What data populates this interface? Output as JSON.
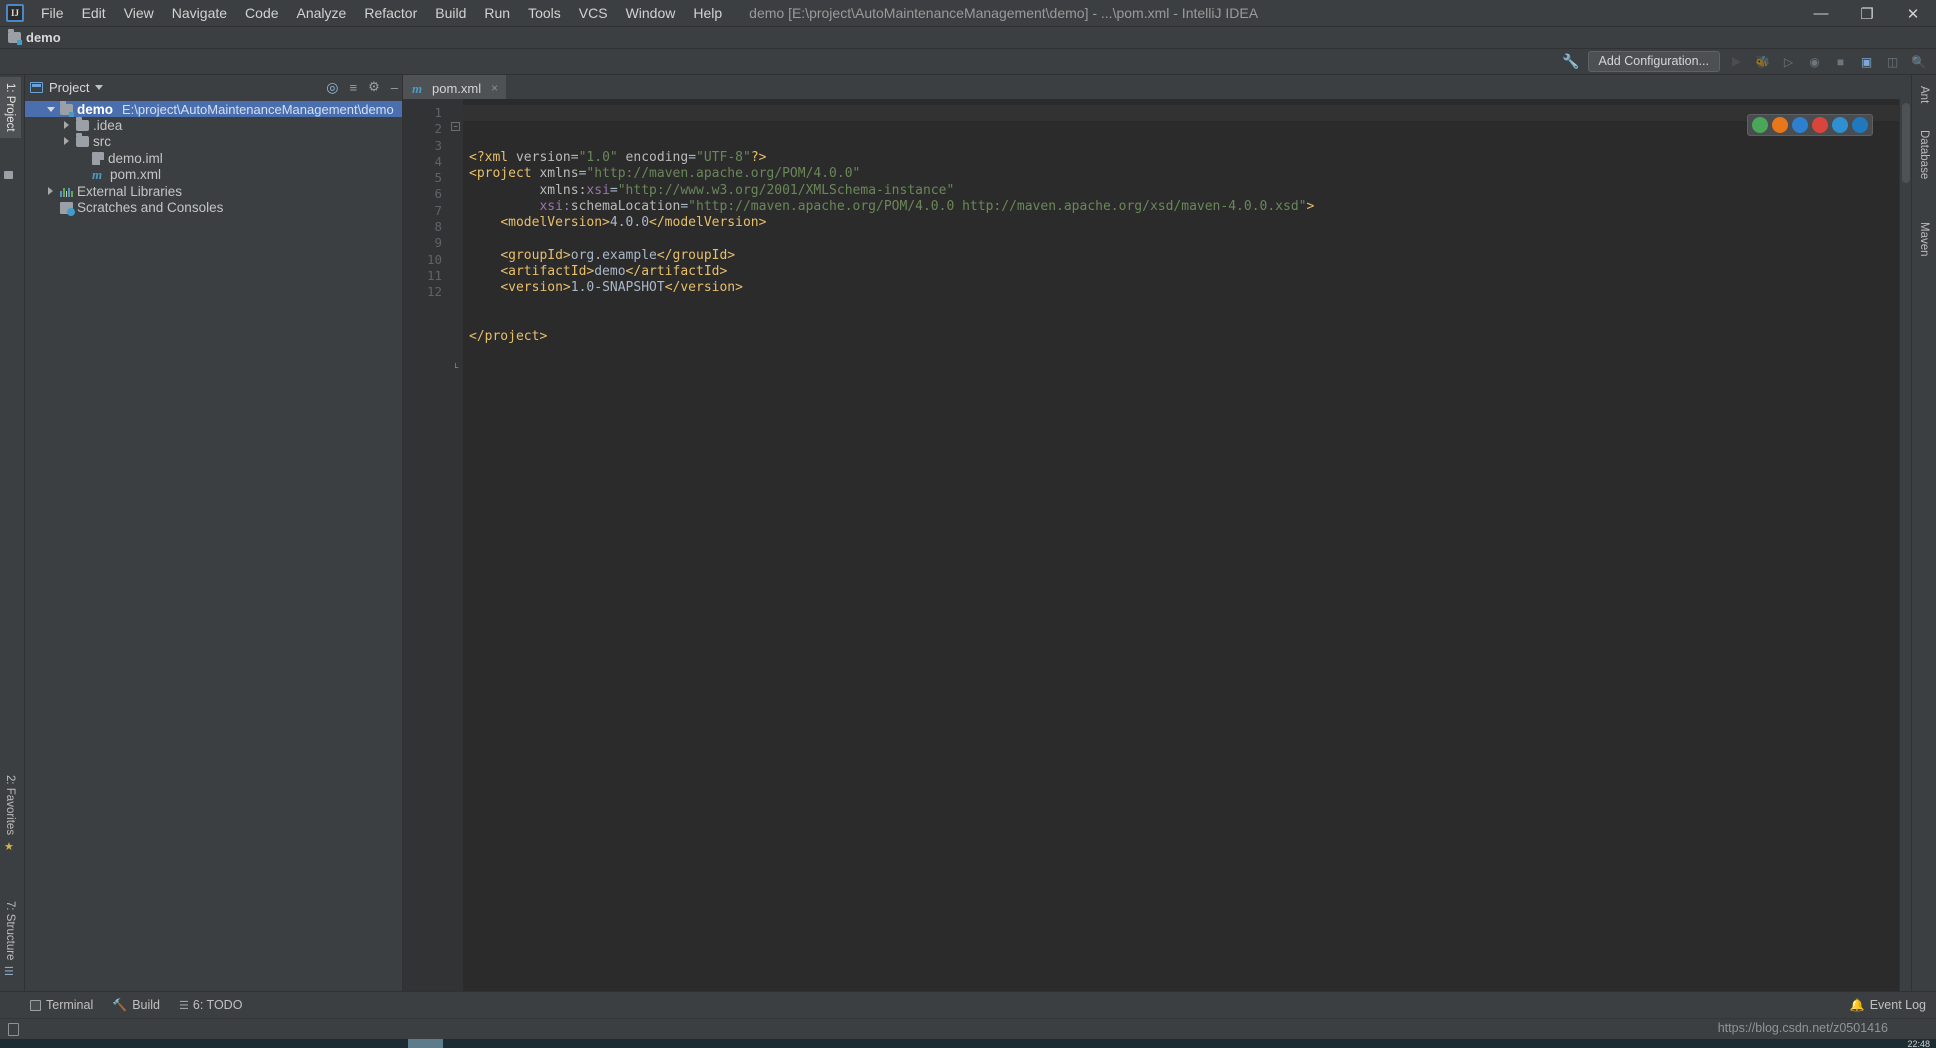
{
  "window": {
    "title": "demo [E:\\project\\AutoMaintenanceManagement\\demo] - ...\\pom.xml - IntelliJ IDEA",
    "logo": "IJ",
    "minimize": "—",
    "maximize": "❐",
    "close": "✕"
  },
  "menu": {
    "items": [
      "File",
      "Edit",
      "View",
      "Navigate",
      "Code",
      "Analyze",
      "Refactor",
      "Build",
      "Run",
      "Tools",
      "VCS",
      "Window",
      "Help"
    ]
  },
  "navbar": {
    "project_name": "demo",
    "search_icon": "search-icon"
  },
  "toolbar": {
    "wrench_icon": "wrench-icon",
    "add_configuration": "Add Configuration...",
    "run_icon": "run-icon",
    "debug_icon": "debug-icon",
    "coverage_icon": "coverage-icon",
    "profile_icon": "profile-icon",
    "stop_icon": "stop-icon",
    "updates_icon": "updates-icon",
    "layout_icon": "layout-icon",
    "search_everywhere_icon": "search-everywhere-icon"
  },
  "left_strip": {
    "project_tab": "1: Project",
    "favorites_tab": "2: Favorites",
    "structure_tab": "7: Structure"
  },
  "right_strip": {
    "tabs": [
      "Ant",
      "Database",
      "Maven"
    ]
  },
  "project_panel": {
    "title": "Project",
    "locate_icon": "locate-file-icon",
    "collapse_icon": "collapse-all-icon",
    "settings_icon": "gear-icon",
    "hide_icon": "hide-icon",
    "tree": [
      {
        "label": "demo",
        "path": "E:\\project\\AutoMaintenanceManagement\\demo",
        "icon": "module-folder-icon",
        "indent": 0,
        "arrow": "down",
        "selected": true,
        "bold": true
      },
      {
        "label": ".idea",
        "path": "",
        "icon": "folder-icon",
        "indent": 1,
        "arrow": "right",
        "selected": false,
        "bold": false
      },
      {
        "label": "src",
        "path": "",
        "icon": "folder-icon",
        "indent": 1,
        "arrow": "right",
        "selected": false,
        "bold": false
      },
      {
        "label": "demo.iml",
        "path": "",
        "icon": "iml-file-icon",
        "indent": 2,
        "arrow": "none",
        "selected": false,
        "bold": false
      },
      {
        "label": "pom.xml",
        "path": "",
        "icon": "maven-file-icon",
        "indent": 2,
        "arrow": "none",
        "selected": false,
        "bold": false
      },
      {
        "label": "External Libraries",
        "path": "",
        "icon": "libraries-icon",
        "indent": 0,
        "arrow": "right",
        "selected": false,
        "bold": false
      },
      {
        "label": "Scratches and Consoles",
        "path": "",
        "icon": "scratches-icon",
        "indent": 0,
        "arrow": "none",
        "selected": false,
        "bold": false
      }
    ]
  },
  "editor": {
    "tab": {
      "label": "pom.xml",
      "icon": "maven-file-icon",
      "close": "×"
    },
    "inspection_status": "✓",
    "line_numbers": [
      "1",
      "2",
      "3",
      "4",
      "5",
      "6",
      "7",
      "8",
      "9",
      "10",
      "11",
      "12"
    ],
    "code_lines": [
      {
        "n": 1,
        "segs": [
          {
            "t": "pi",
            "v": "<?xml "
          },
          {
            "t": "attr",
            "v": "version"
          },
          {
            "t": "eq",
            "v": "="
          },
          {
            "t": "str",
            "v": "\"1.0\""
          },
          {
            "t": "attr",
            "v": " encoding"
          },
          {
            "t": "eq",
            "v": "="
          },
          {
            "t": "str",
            "v": "\"UTF-8\""
          },
          {
            "t": "pi",
            "v": "?>"
          }
        ]
      },
      {
        "n": 2,
        "segs": [
          {
            "t": "tag",
            "v": "<project "
          },
          {
            "t": "attr",
            "v": "xmlns"
          },
          {
            "t": "eq",
            "v": "="
          },
          {
            "t": "str",
            "v": "\"http://maven.apache.org/POM/4.0.0\""
          }
        ]
      },
      {
        "n": 3,
        "segs": [
          {
            "t": "txt",
            "v": "         "
          },
          {
            "t": "attr",
            "v": "xmlns:"
          },
          {
            "t": "attrns",
            "v": "xsi"
          },
          {
            "t": "eq",
            "v": "="
          },
          {
            "t": "str",
            "v": "\"http://www.w3.org/2001/XMLSchema-instance\""
          }
        ]
      },
      {
        "n": 4,
        "segs": [
          {
            "t": "txt",
            "v": "         "
          },
          {
            "t": "attrns",
            "v": "xsi:"
          },
          {
            "t": "attr",
            "v": "schemaLocation"
          },
          {
            "t": "eq",
            "v": "="
          },
          {
            "t": "str",
            "v": "\"http://maven.apache.org/POM/4.0.0 http://maven.apache.org/xsd/maven-4.0.0.xsd\""
          },
          {
            "t": "tag",
            "v": ">"
          }
        ]
      },
      {
        "n": 5,
        "segs": [
          {
            "t": "txt",
            "v": "    "
          },
          {
            "t": "tag",
            "v": "<modelVersion>"
          },
          {
            "t": "txt",
            "v": "4.0.0"
          },
          {
            "t": "tag",
            "v": "</modelVersion>"
          }
        ]
      },
      {
        "n": 6,
        "segs": []
      },
      {
        "n": 7,
        "segs": [
          {
            "t": "txt",
            "v": "    "
          },
          {
            "t": "tag",
            "v": "<groupId>"
          },
          {
            "t": "txt",
            "v": "org.example"
          },
          {
            "t": "tag",
            "v": "</groupId>"
          }
        ]
      },
      {
        "n": 8,
        "segs": [
          {
            "t": "txt",
            "v": "    "
          },
          {
            "t": "tag",
            "v": "<artifactId>"
          },
          {
            "t": "txt",
            "v": "demo"
          },
          {
            "t": "tag",
            "v": "</artifactId>"
          }
        ]
      },
      {
        "n": 9,
        "segs": [
          {
            "t": "txt",
            "v": "    "
          },
          {
            "t": "tag",
            "v": "<version>"
          },
          {
            "t": "txt",
            "v": "1.0-SNAPSHOT"
          },
          {
            "t": "tag",
            "v": "</version>"
          }
        ]
      },
      {
        "n": 10,
        "segs": []
      },
      {
        "n": 11,
        "segs": []
      },
      {
        "n": 12,
        "segs": [
          {
            "t": "tag",
            "v": "</project>"
          }
        ]
      }
    ],
    "browser_popup": {
      "icons": [
        "chrome-icon",
        "firefox-icon",
        "opera-icon",
        "ie-icon",
        "edge-icon",
        "explorer-icon"
      ],
      "colors": [
        "#4aa75a",
        "#e8761b",
        "#2f7fd0",
        "#d9453b",
        "#2f8fd0",
        "#2179bd"
      ]
    }
  },
  "status_bar": {
    "terminal": "Terminal",
    "build": "Build",
    "todo": "6: TODO",
    "event_log": "Event Log"
  },
  "watermark": "https://blog.csdn.net/z0501416",
  "clock": "22:48",
  "colors": {
    "accent": "#4b6eaf",
    "editor_bg": "#2b2b2b",
    "panel_bg": "#3c3f41",
    "gutter_bg": "#313335",
    "tag": "#e8bf6a",
    "string": "#6a8759",
    "text": "#a9b7c6",
    "namespace": "#9876aa"
  }
}
